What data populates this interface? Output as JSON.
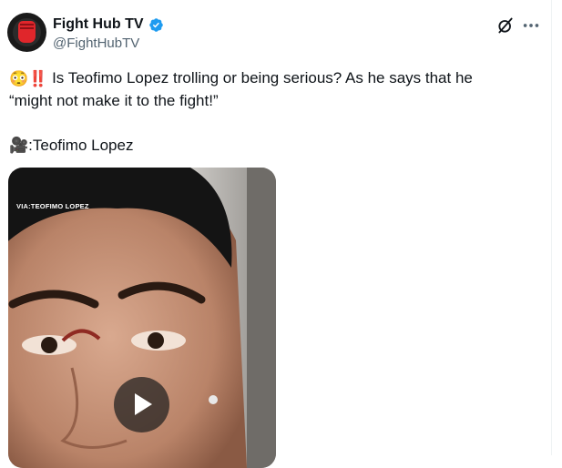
{
  "author": {
    "name": "Fight Hub TV",
    "handle": "@FightHubTV",
    "verified": true,
    "verified_color": "#1d9bf0"
  },
  "icons": {
    "avatar": "fight-hub-logo",
    "grok": "grok-icon",
    "more": "more-icon",
    "verified": "verified-badge-icon",
    "play": "play-icon"
  },
  "tweet": {
    "emoji_lead": "😳‼️",
    "text": "Is Teofimo Lopez trolling or being serious? As he says that he “might not make it to the fight!”",
    "credit_emoji": "🎥",
    "credit": ":Teofimo Lopez"
  },
  "media": {
    "type": "video",
    "watermark": "VIA:TEOFIMO LOPEZ"
  },
  "colors": {
    "text": "#0f1419",
    "secondary": "#536471",
    "accent": "#1d9bf0"
  }
}
